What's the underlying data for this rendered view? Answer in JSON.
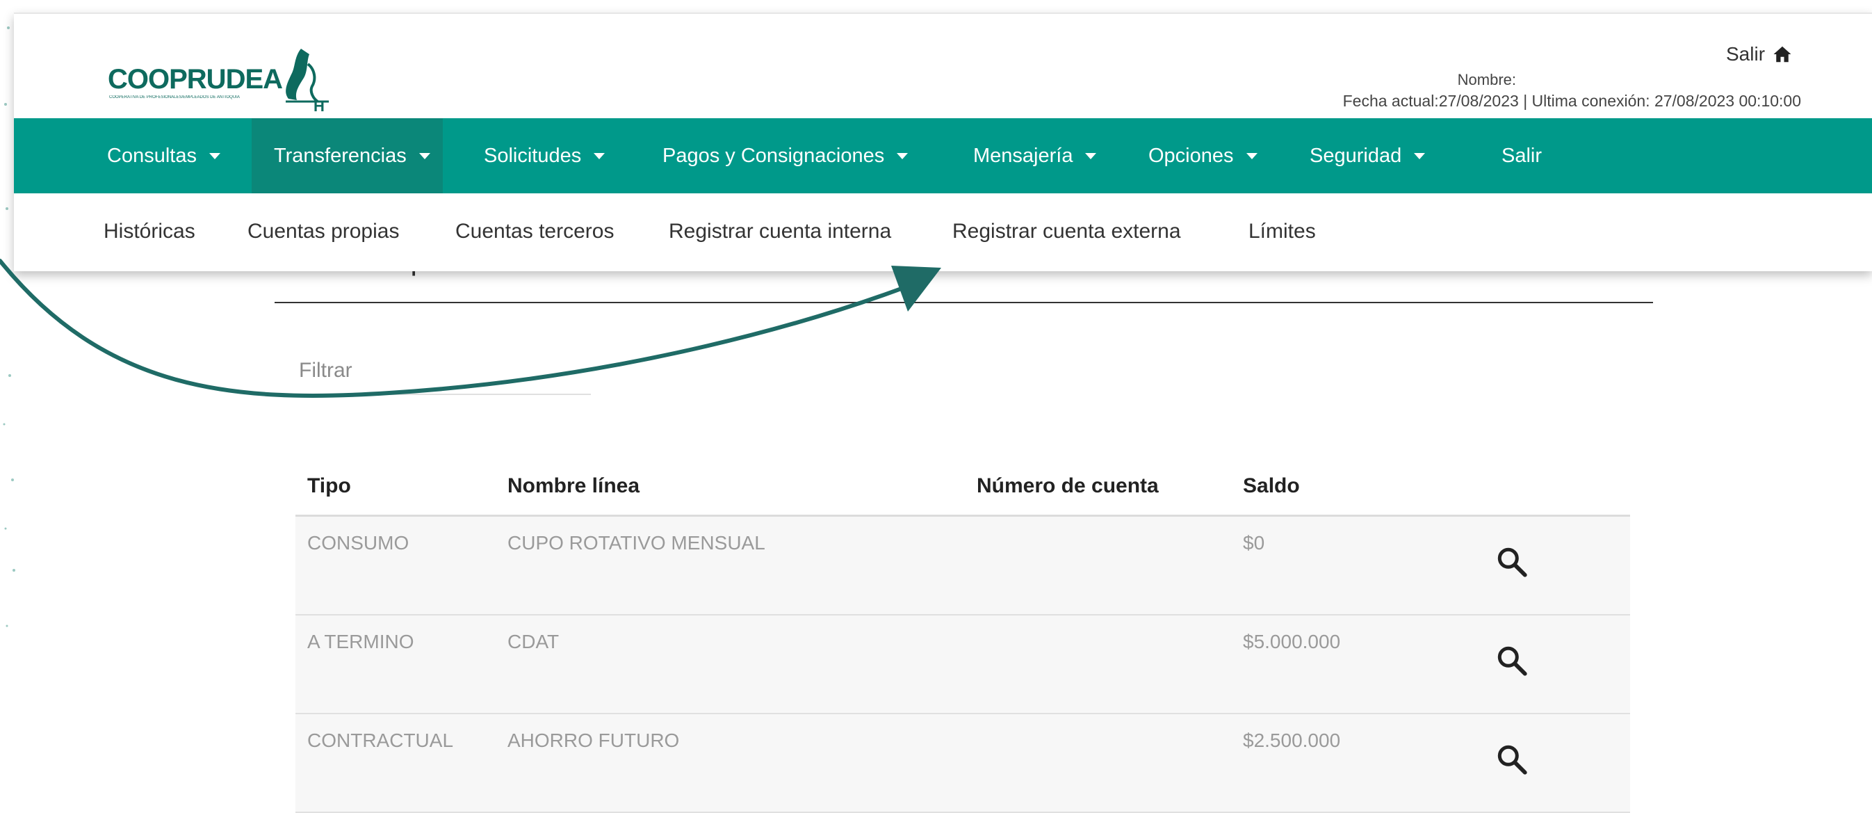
{
  "brand": {
    "name": "COOPRUDEA",
    "tagline": "COOPERATIVA DE PROFESIONALES/EMPLEADOS DE ANTIOQUIA"
  },
  "header": {
    "exit_label": "Salir",
    "name_label": "Nombre:",
    "date_line": "Fecha actual:27/08/2023 | Ultima conexión: 27/08/2023 00:10:00"
  },
  "nav": {
    "items": [
      {
        "label": "Consultas",
        "caret": true
      },
      {
        "label": "Transferencias",
        "caret": true,
        "active": true
      },
      {
        "label": "Solicitudes",
        "caret": true
      },
      {
        "label": "Pagos y Consignaciones",
        "caret": true
      },
      {
        "label": "Mensajería",
        "caret": true
      },
      {
        "label": "Opciones",
        "caret": true
      },
      {
        "label": "Seguridad",
        "caret": true
      },
      {
        "label": "Salir",
        "caret": false
      }
    ]
  },
  "subnav": {
    "items": [
      "Históricas",
      "Cuentas propias",
      "Cuentas terceros",
      "Registrar cuenta interna",
      "Registrar cuenta externa",
      "Límites"
    ]
  },
  "content": {
    "section_title": "Saldos de productos",
    "filter_placeholder": "Filtrar",
    "table": {
      "headers": [
        "Tipo",
        "Nombre línea",
        "Número de cuenta",
        "Saldo"
      ],
      "rows": [
        {
          "tipo": "CONSUMO",
          "nombre": "CUPO ROTATIVO MENSUAL",
          "numero": "",
          "saldo": "$0"
        },
        {
          "tipo": "A TERMINO",
          "nombre": "CDAT",
          "numero": "",
          "saldo": "$5.000.000"
        },
        {
          "tipo": "CONTRACTUAL",
          "nombre": "AHORRO FUTURO",
          "numero": "",
          "saldo": "$2.500.000"
        }
      ]
    }
  },
  "colors": {
    "nav_bg": "#00998a",
    "nav_active": "#0b8779",
    "brand": "#0e6a5e",
    "arrow": "#1f6b66"
  },
  "icons": [
    "home-icon",
    "search-icon",
    "caret-down-icon",
    "curved-arrow-icon"
  ]
}
